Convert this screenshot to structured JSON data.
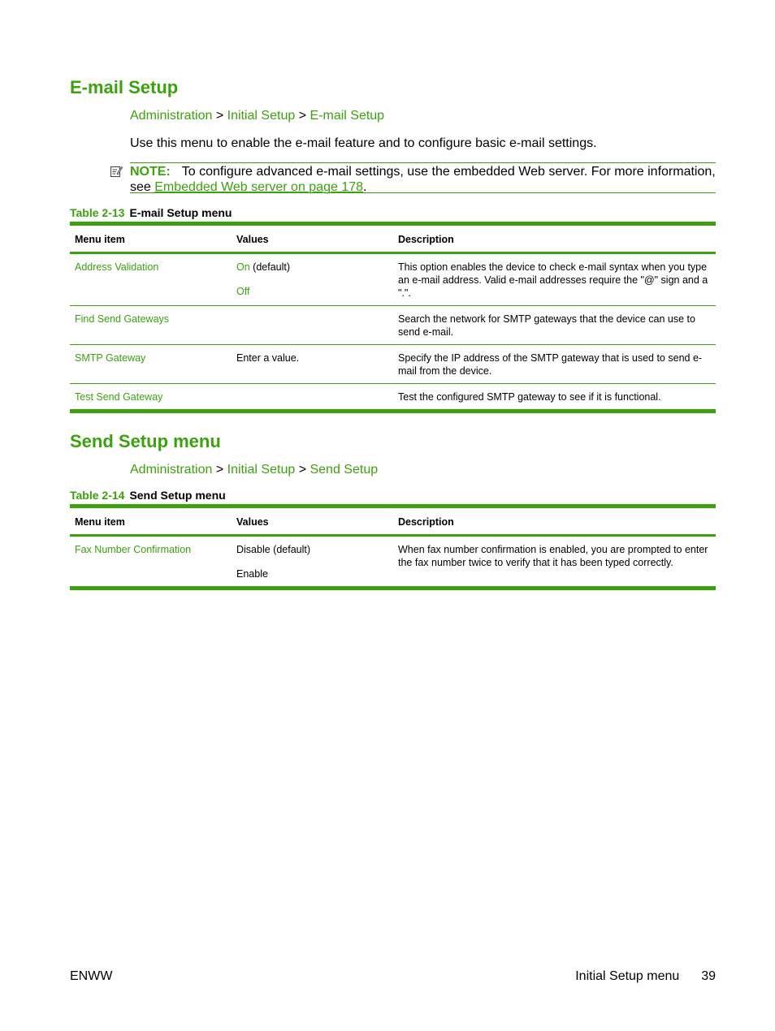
{
  "sections": [
    {
      "title": "E-mail Setup",
      "breadcrumb": {
        "items": [
          "Administration",
          "Initial Setup",
          "E-mail Setup"
        ],
        "separator": ">"
      },
      "intro": "Use this menu to enable the e-mail feature and to configure basic e-mail settings.",
      "note": {
        "label": "NOTE:",
        "text": "To configure advanced e-mail settings, use the embedded Web server. For more information, see ",
        "link": "Embedded Web server on page 178",
        "end": "."
      },
      "table": {
        "number": "Table 2-13",
        "title": "E-mail Setup menu",
        "headers": [
          "Menu item",
          "Values",
          "Description"
        ],
        "rows": [
          {
            "item": "Address Validation",
            "values": [
              {
                "text": "On",
                "suffix": " (default)",
                "link": true
              },
              {
                "text": "Off",
                "suffix": "",
                "link": true
              }
            ],
            "description": "This option enables the device to check e-mail syntax when you type an e-mail address. Valid e-mail addresses require the \"@\" sign and a \".\"."
          },
          {
            "item": "Find Send Gateways",
            "values": [],
            "description": "Search the network for SMTP gateways that the device can use to send e-mail."
          },
          {
            "item": "SMTP Gateway",
            "values": [
              {
                "text": "Enter a value.",
                "suffix": "",
                "link": false
              }
            ],
            "description": "Specify the IP address of the SMTP gateway that is used to send e-mail from the device."
          },
          {
            "item": "Test Send Gateway",
            "values": [],
            "description": "Test the configured SMTP gateway to see if it is functional."
          }
        ]
      }
    },
    {
      "title": "Send Setup menu",
      "breadcrumb": {
        "items": [
          "Administration",
          "Initial Setup",
          "Send Setup"
        ],
        "separator": ">"
      },
      "table": {
        "number": "Table 2-14",
        "title": "Send Setup menu",
        "headers": [
          "Menu item",
          "Values",
          "Description"
        ],
        "rows": [
          {
            "item": "Fax Number Confirmation",
            "values": [
              {
                "text": "Disable (default)",
                "suffix": "",
                "link": false
              },
              {
                "text": "Enable",
                "suffix": "",
                "link": false
              }
            ],
            "description": "When fax number confirmation is enabled, you are prompted to enter the fax number twice to verify that it has been typed correctly."
          }
        ]
      }
    }
  ],
  "footer": {
    "left": "ENWW",
    "section": "Initial Setup menu",
    "page": "39"
  },
  "colors": {
    "accent": "#3aa30a",
    "text": "#000000"
  }
}
